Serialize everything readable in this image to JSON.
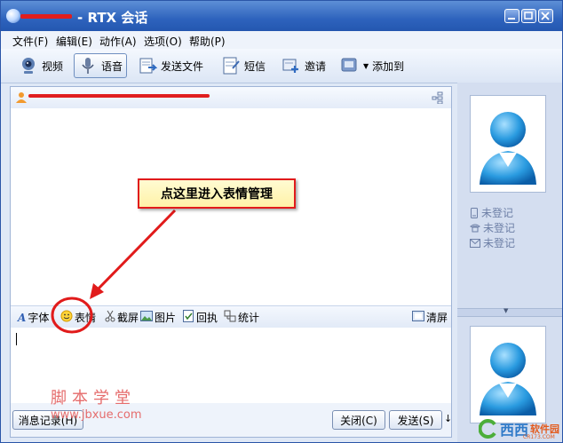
{
  "window": {
    "title": "- RTX 会话"
  },
  "menu": [
    {
      "label": "文件(F)"
    },
    {
      "label": "编辑(E)"
    },
    {
      "label": "动作(A)"
    },
    {
      "label": "选项(O)"
    },
    {
      "label": "帮助(P)"
    }
  ],
  "toolbar": {
    "video": "视频",
    "voice": "语音",
    "send_file": "发送文件",
    "sms": "短信",
    "invite": "邀请",
    "add_to": "添加到"
  },
  "format_bar": {
    "font": "字体",
    "emoticon": "表情",
    "screenshot": "截屏",
    "picture": "图片",
    "receipt": "回执",
    "stats": "统计",
    "clear": "清屏"
  },
  "bottom": {
    "history": "消息记录(H)",
    "close": "关闭(C)",
    "send": "发送(S)"
  },
  "contact_info": [
    {
      "icon": "phone-icon",
      "text": "未登记"
    },
    {
      "icon": "telephone-icon",
      "text": "未登记"
    },
    {
      "icon": "mail-icon",
      "text": "未登记"
    }
  ],
  "annotation": {
    "callout": "点这里进入表情管理"
  },
  "watermark": {
    "line1": "脚本学堂",
    "line2": "www.jbxue.com"
  },
  "brand": {
    "text": "西西",
    "sub": "软件园",
    "sub2": "CR173.COM"
  },
  "colors": {
    "title_bar": "#2e63bd",
    "annotation_red": "#e11b1b",
    "callout_fill": "#fff5b0"
  }
}
